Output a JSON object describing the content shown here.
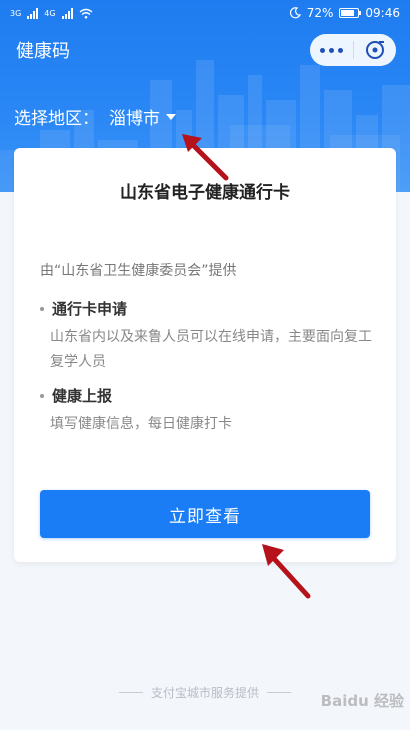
{
  "status_bar": {
    "net1": "3G",
    "net2": "4G",
    "battery": "72%",
    "time": "09:46"
  },
  "header": {
    "title": "健康码"
  },
  "region": {
    "label": "选择地区：",
    "value": "淄博市"
  },
  "card": {
    "title": "山东省电子健康通行卡",
    "provider": "由“山东省卫生健康委员会”提供",
    "sections": [
      {
        "title": "通行卡申请",
        "desc": "山东省内以及来鲁人员可以在线申请，主要面向复工复学人员"
      },
      {
        "title": "健康上报",
        "desc": "填写健康信息，每日健康打卡"
      }
    ],
    "button_label": "立即查看"
  },
  "footer": {
    "text": "支付宝城市服务提供"
  },
  "watermark": "Baidu 经验",
  "colors": {
    "primary": "#1a7df5",
    "header": "#1f7cf0",
    "annotation_arrow": "#b5121b"
  },
  "icons": [
    "signal-icon",
    "wifi-icon",
    "moon-icon",
    "battery-icon",
    "more-dots-icon",
    "close-target-icon",
    "dropdown-caret-icon"
  ]
}
